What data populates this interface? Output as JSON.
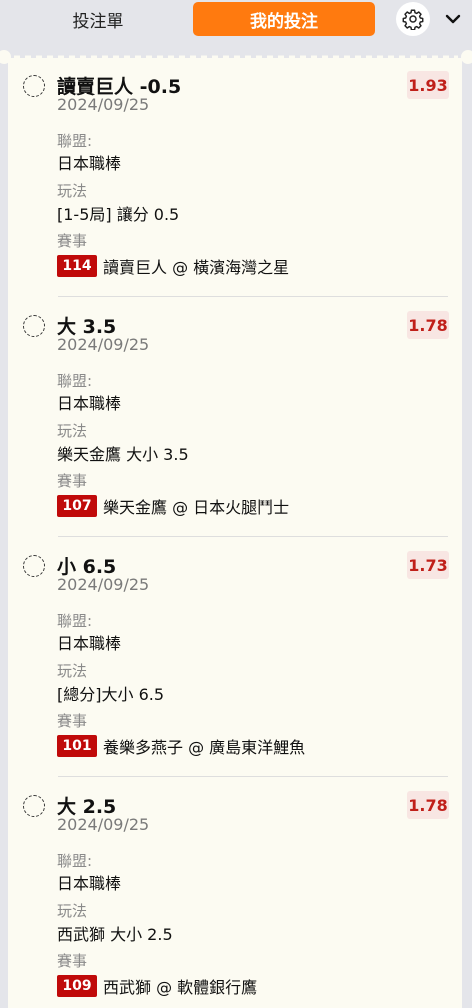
{
  "header": {
    "tab_betslip": "投注單",
    "tab_mybets": "我的投注"
  },
  "colors": {
    "accent": "#ff7a0f",
    "odds_text": "#c0201a",
    "match_badge": "#c00a0a",
    "panel_bg": "#fcfbf2"
  },
  "labels": {
    "league": "聯盟:",
    "market": "玩法",
    "event": "賽事"
  },
  "bets": [
    {
      "title": "讀賣巨人 -0.5",
      "date": "2024/09/25",
      "odds": "1.93",
      "league": "日本職棒",
      "market": "[1-5局] 讓分 0.5",
      "match_no": "114",
      "match": "讀賣巨人 @ 橫濱海灣之星"
    },
    {
      "title": "大 3.5",
      "date": "2024/09/25",
      "odds": "1.78",
      "league": "日本職棒",
      "market": "樂天金鷹 大小 3.5",
      "match_no": "107",
      "match": "樂天金鷹 @ 日本火腿鬥士"
    },
    {
      "title": "小 6.5",
      "date": "2024/09/25",
      "odds": "1.73",
      "league": "日本職棒",
      "market": "[總分]大小 6.5",
      "match_no": "101",
      "match": "養樂多燕子 @ 廣島東洋鯉魚"
    },
    {
      "title": "大 2.5",
      "date": "2024/09/25",
      "odds": "1.78",
      "league": "日本職棒",
      "market": "西武獅 大小 2.5",
      "match_no": "109",
      "match": "西武獅 @ 軟體銀行鷹"
    }
  ]
}
